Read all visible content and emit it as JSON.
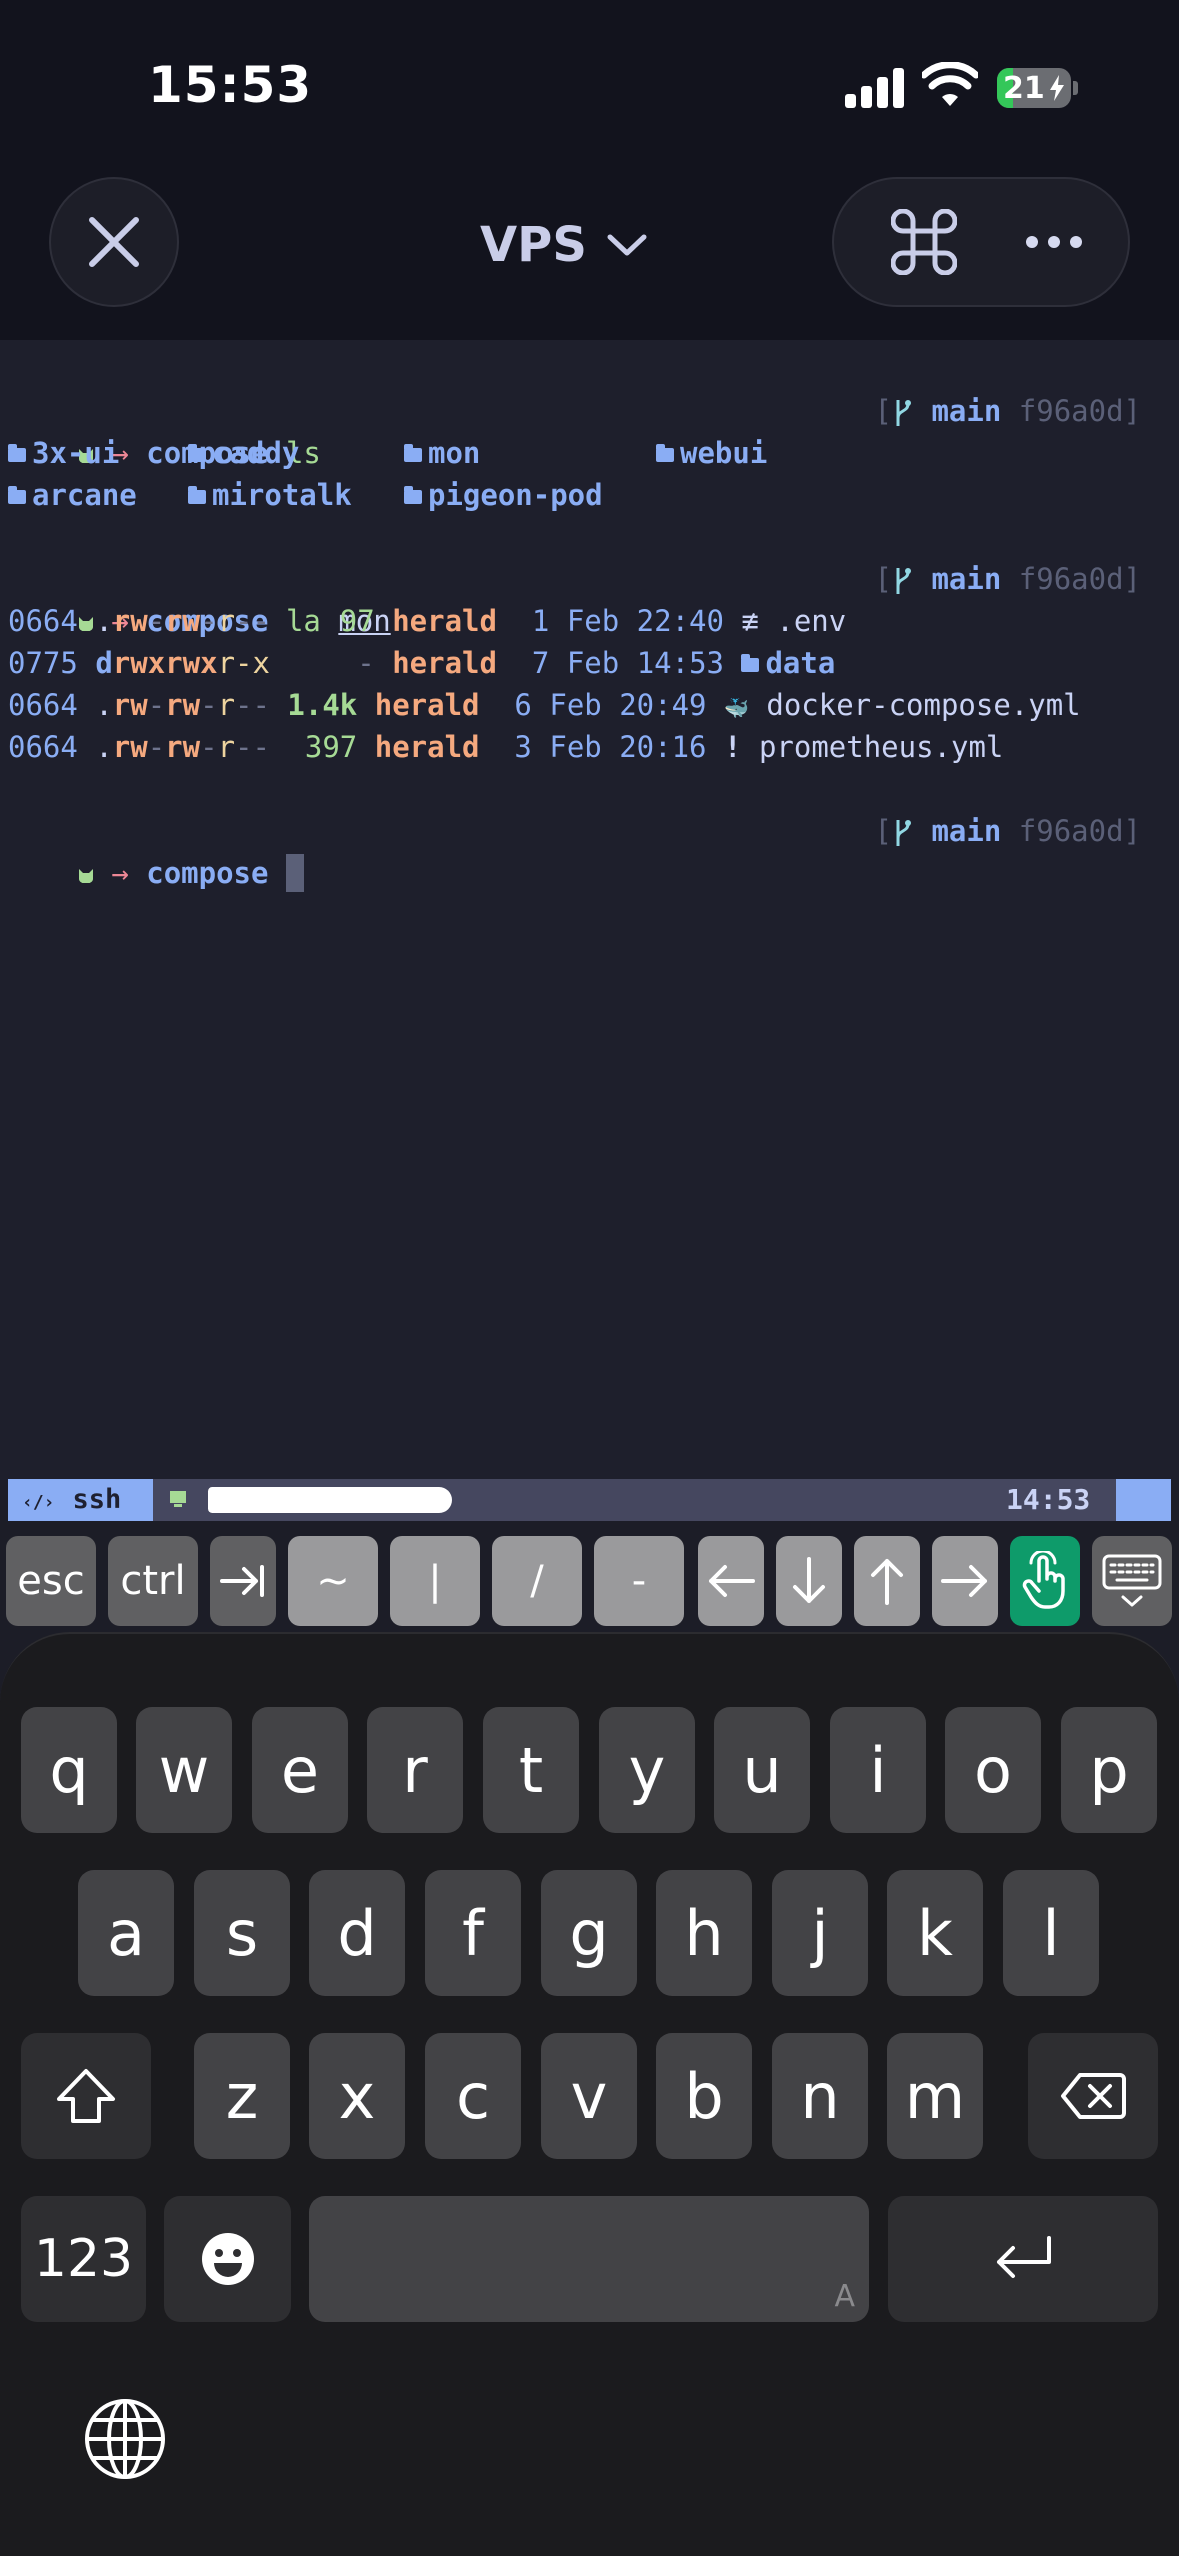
{
  "status_bar": {
    "time": "15:53",
    "battery": "21"
  },
  "header": {
    "title": "VPS"
  },
  "terminal": {
    "prompt_dir": "compose",
    "git_branch": "main",
    "git_hash": "f96a0d]",
    "bracket_open": "[",
    "cmd1": "ls",
    "ls_entries": [
      "3x-ui",
      "caddy",
      "mon",
      "webui",
      "arcane",
      "mirotalk",
      "pigeon-pod"
    ],
    "cmd2": "la",
    "cmd2_arg": "mon",
    "la_rows": [
      {
        "octal": "0664",
        "perm": [
          ".",
          "rw",
          "-",
          "rw",
          "-",
          "r",
          "--"
        ],
        "size": "97",
        "user": "herald",
        "day": "1",
        "month": "Feb",
        "time": "22:40",
        "icon": "≢",
        "name": ".env",
        "dir": false
      },
      {
        "octal": "0775",
        "perm": [
          "d",
          "rwx",
          "",
          "rwx",
          "",
          "r-x",
          ""
        ],
        "size": "-",
        "user": "herald",
        "day": "7",
        "month": "Feb",
        "time": "14:53",
        "icon": "folder",
        "name": "data",
        "dir": true
      },
      {
        "octal": "0664",
        "perm": [
          ".",
          "rw",
          "-",
          "rw",
          "-",
          "r",
          "--"
        ],
        "size": "1.4k",
        "user": "herald",
        "day": "6",
        "month": "Feb",
        "time": "20:49",
        "icon": "🐳",
        "name": "docker-compose.yml",
        "dir": false
      },
      {
        "octal": "0664",
        "perm": [
          ".",
          "rw",
          "-",
          "rw",
          "-",
          "r",
          "--"
        ],
        "size": "397",
        "user": "herald",
        "day": "3",
        "month": "Feb",
        "time": "20:16",
        "icon": "!",
        "name": "prometheus.yml",
        "dir": false
      }
    ]
  },
  "tmux": {
    "session": "ssh",
    "time": "14:53"
  },
  "accessory_keys": [
    "esc",
    "ctrl",
    "⇥",
    "~",
    "|",
    "/",
    "-",
    "←",
    "↓",
    "↑",
    "→"
  ],
  "keyboard": {
    "row1": [
      "q",
      "w",
      "e",
      "r",
      "t",
      "y",
      "u",
      "i",
      "o",
      "p"
    ],
    "row2": [
      "a",
      "s",
      "d",
      "f",
      "g",
      "h",
      "j",
      "k",
      "l"
    ],
    "row3": [
      "z",
      "x",
      "c",
      "v",
      "b",
      "n",
      "m"
    ],
    "numbers_label": "123",
    "space_hint": "A"
  },
  "colors": {
    "accent_blue": "#8aadf4",
    "pointer_green": "#0e9b6a",
    "terminal_bg": "#1e1f2c"
  }
}
